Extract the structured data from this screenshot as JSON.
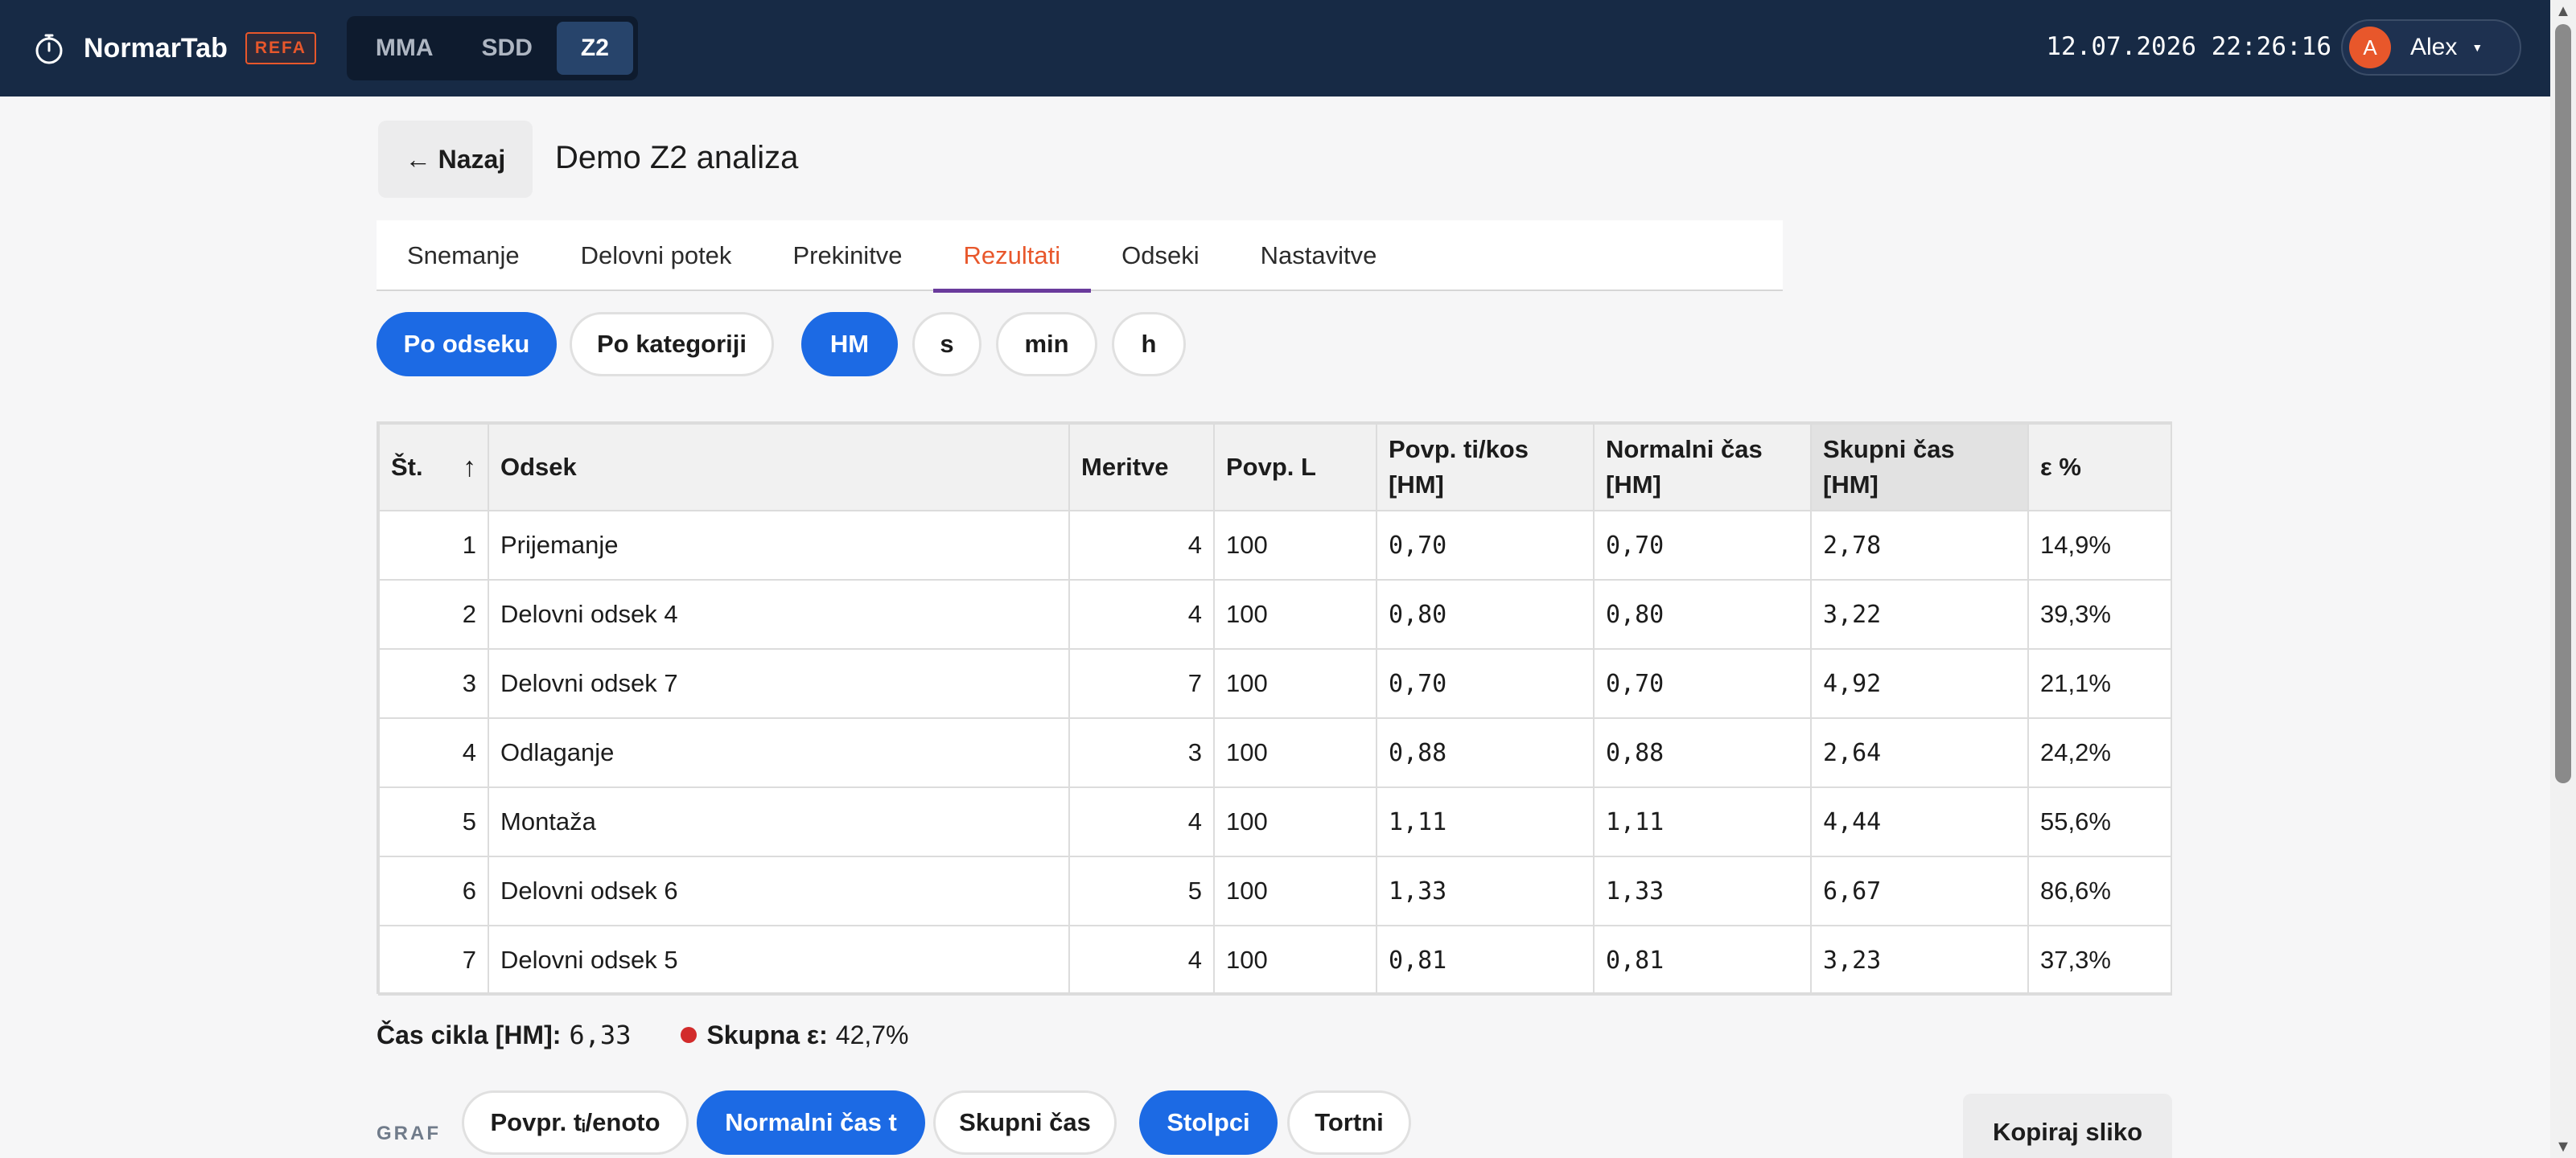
{
  "app": {
    "name": "NormarTab",
    "badge": "REFA",
    "modes": [
      "MMA",
      "SDD",
      "Z2"
    ],
    "active_mode": "Z2",
    "datetime": "12.07.2026 22:26:16",
    "user": {
      "initial": "A",
      "name": "Alex"
    }
  },
  "header": {
    "back_label": "← Nazaj",
    "title": "Demo Z2 analiza"
  },
  "tabs": [
    "Snemanje",
    "Delovni potek",
    "Prekinitve",
    "Rezultati",
    "Odseki",
    "Nastavitve"
  ],
  "active_tab": "Rezultati",
  "view_toggle": {
    "by_section": "Po odseku",
    "by_category": "Po kategoriji",
    "active": "Po odseku"
  },
  "units": {
    "options": [
      "HM",
      "s",
      "min",
      "h"
    ],
    "active": "HM"
  },
  "table": {
    "columns": {
      "num": "Št.",
      "section": "Odsek",
      "measurements": "Meritve",
      "avg_l": "Povp. L",
      "avg_ti_a": "Povp. ti/kos",
      "avg_ti_b": "[HM]",
      "normal_a": "Normalni čas",
      "normal_b": "[HM]",
      "total": "Skupni čas [HM]",
      "eps": "ε %"
    },
    "sort_arrow": "↑",
    "rows": [
      {
        "num": "1",
        "section": "Prijemanje",
        "measurements": "4",
        "avg_l": "100",
        "avg_ti": "0,70",
        "normal": "0,70",
        "total": "2,78",
        "eps": "14,9%"
      },
      {
        "num": "2",
        "section": "Delovni odsek 4",
        "measurements": "4",
        "avg_l": "100",
        "avg_ti": "0,80",
        "normal": "0,80",
        "total": "3,22",
        "eps": "39,3%"
      },
      {
        "num": "3",
        "section": "Delovni odsek 7",
        "measurements": "7",
        "avg_l": "100",
        "avg_ti": "0,70",
        "normal": "0,70",
        "total": "4,92",
        "eps": "21,1%"
      },
      {
        "num": "4",
        "section": "Odlaganje",
        "measurements": "3",
        "avg_l": "100",
        "avg_ti": "0,88",
        "normal": "0,88",
        "total": "2,64",
        "eps": "24,2%"
      },
      {
        "num": "5",
        "section": "Montaža",
        "measurements": "4",
        "avg_l": "100",
        "avg_ti": "1,11",
        "normal": "1,11",
        "total": "4,44",
        "eps": "55,6%"
      },
      {
        "num": "6",
        "section": "Delovni odsek 6",
        "measurements": "5",
        "avg_l": "100",
        "avg_ti": "1,33",
        "normal": "1,33",
        "total": "6,67",
        "eps": "86,6%"
      },
      {
        "num": "7",
        "section": "Delovni odsek 5",
        "measurements": "4",
        "avg_l": "100",
        "avg_ti": "0,81",
        "normal": "0,81",
        "total": "3,23",
        "eps": "37,3%"
      }
    ]
  },
  "summary": {
    "cycle_label": "Čas cikla [HM]:",
    "cycle_value": "6,33",
    "group_eps_label": "Skupna ε:",
    "group_eps_value": "42,7%",
    "status_color": "#d22b2b"
  },
  "graph": {
    "label": "GRAF",
    "metrics": [
      "Povpr. tᵢ/enoto",
      "Normalni čas t",
      "Skupni čas"
    ],
    "active_metric": "Normalni čas t",
    "types": [
      "Stolpci",
      "Tortni"
    ],
    "active_type": "Stolpci",
    "copy_label": "Kopiraj sliko"
  },
  "colors": {
    "accent": "#1c6ae4",
    "brand": "#e8572b",
    "topbar": "#172a45",
    "tab_underline": "#6a3b9c"
  }
}
